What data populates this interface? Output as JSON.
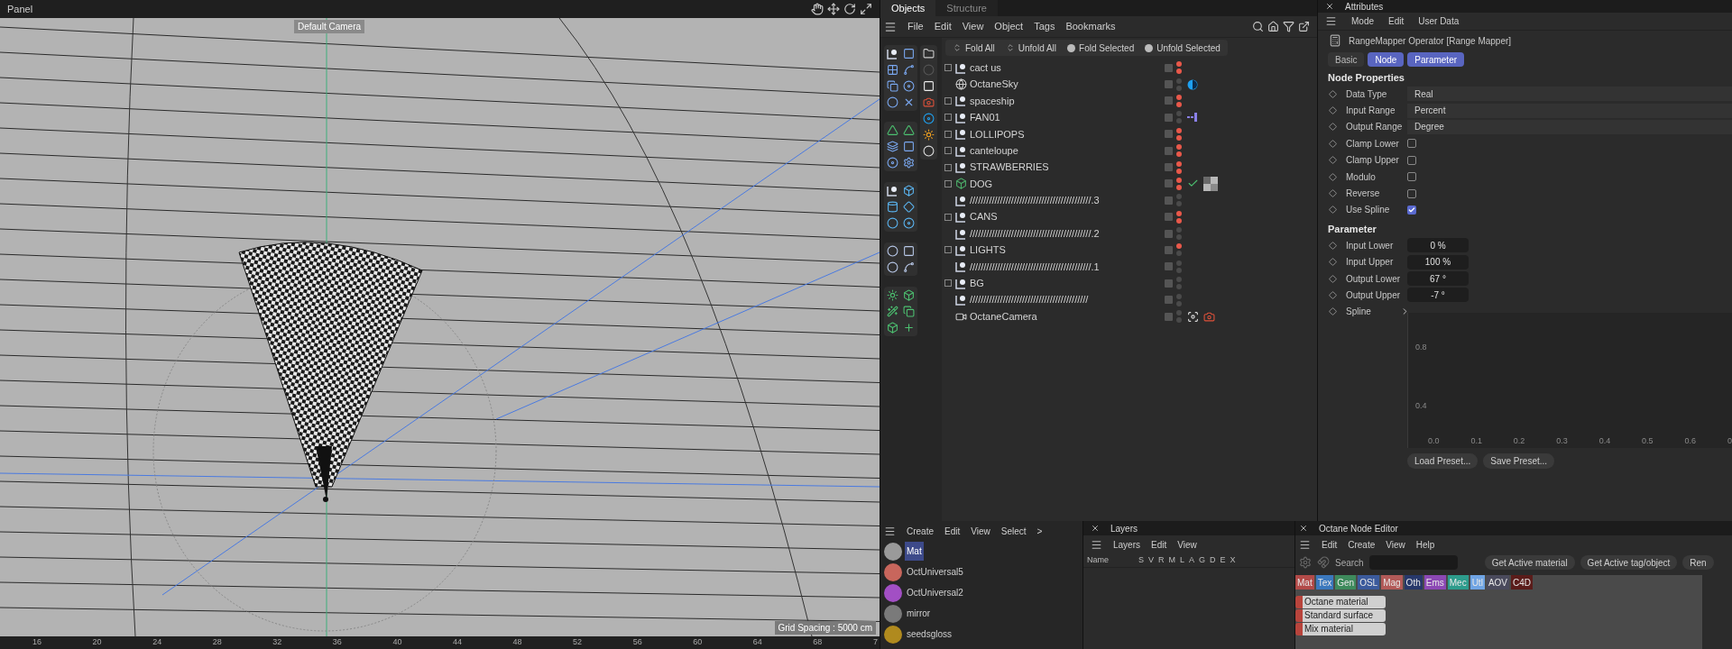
{
  "viewport": {
    "panel_menu": "Panel",
    "camera": "Default Camera",
    "grid_spacing": "Grid Spacing : 5000 cm",
    "ruler": [
      "16",
      "20",
      "24",
      "28",
      "32",
      "36",
      "40",
      "44",
      "48",
      "52",
      "56",
      "60",
      "64",
      "68",
      "7"
    ]
  },
  "object_manager": {
    "tabs": [
      {
        "label": "Objects",
        "selected": true
      },
      {
        "label": "Structure",
        "selected": false
      }
    ],
    "menu": [
      "File",
      "Edit",
      "View",
      "Object",
      "Tags",
      "Bookmarks"
    ],
    "fold_buttons": [
      {
        "label": "Fold All",
        "kind": "fold"
      },
      {
        "label": "Unfold All",
        "kind": "unfold"
      },
      {
        "label": "Fold Selected",
        "kind": "dot"
      },
      {
        "label": "Unfold Selected",
        "kind": "dot"
      }
    ],
    "objects": [
      {
        "name": "cact us",
        "kind": "null",
        "expandable": true,
        "editor_hidden": true,
        "render_hidden": true
      },
      {
        "name": "OctaneSky",
        "kind": "sky",
        "expandable": false,
        "editor_hidden": false,
        "render_hidden": false,
        "tags": [
          {
            "kind": "sky"
          }
        ]
      },
      {
        "name": "spaceship",
        "kind": "null",
        "expandable": true,
        "editor_hidden": true,
        "render_hidden": true
      },
      {
        "name": "FAN01",
        "kind": "null",
        "expandable": true,
        "editor_hidden": false,
        "render_hidden": false,
        "tags": [
          {
            "kind": "array"
          }
        ]
      },
      {
        "name": "LOLLIPOPS",
        "kind": "null",
        "expandable": true,
        "editor_hidden": true,
        "render_hidden": true
      },
      {
        "name": "canteloupe",
        "kind": "null",
        "expandable": true,
        "editor_hidden": true,
        "render_hidden": true
      },
      {
        "name": "STRAWBERRIES",
        "kind": "null",
        "expandable": true,
        "editor_hidden": true,
        "render_hidden": true
      },
      {
        "name": "DOG",
        "kind": "cube",
        "expandable": true,
        "editor_hidden": true,
        "render_hidden": true,
        "tags": [
          {
            "kind": "check"
          },
          {
            "kind": "texture"
          }
        ]
      },
      {
        "name": "////////////////////////////////////////////.3",
        "kind": "null",
        "expandable": false,
        "editor_hidden": false,
        "render_hidden": false
      },
      {
        "name": "CANS",
        "kind": "null",
        "expandable": true,
        "editor_hidden": true,
        "render_hidden": true
      },
      {
        "name": "////////////////////////////////////////////.2",
        "kind": "null",
        "expandable": false,
        "editor_hidden": false,
        "render_hidden": false
      },
      {
        "name": "LIGHTS",
        "kind": "null",
        "expandable": true,
        "editor_hidden": true,
        "render_hidden": false
      },
      {
        "name": "////////////////////////////////////////////.1",
        "kind": "null",
        "expandable": false,
        "editor_hidden": false,
        "render_hidden": false
      },
      {
        "name": "BG",
        "kind": "null",
        "expandable": true,
        "editor_hidden": false,
        "render_hidden": false
      },
      {
        "name": "///////////////////////////////////////////",
        "kind": "null",
        "expandable": false,
        "editor_hidden": false,
        "render_hidden": false
      },
      {
        "name": "OctaneCamera",
        "kind": "camera",
        "expandable": false,
        "editor_hidden": false,
        "render_hidden": false,
        "tags": [
          {
            "kind": "target"
          },
          {
            "kind": "camera"
          }
        ]
      }
    ]
  },
  "attributes": {
    "title": "Attributes",
    "menu": [
      "Mode",
      "Edit",
      "User Data"
    ],
    "object": "RangeMapper Operator [Range Mapper]",
    "tabs": [
      {
        "label": "Basic",
        "selected": false
      },
      {
        "label": "Node",
        "selected": true
      },
      {
        "label": "Parameter",
        "selected": true
      }
    ],
    "sections": [
      {
        "title": "Node Properties",
        "rows": [
          {
            "label": "Data Type",
            "kind": "dropdown",
            "value": "Real"
          },
          {
            "label": "Input Range",
            "kind": "dropdown",
            "value": "Percent"
          },
          {
            "label": "Output Range",
            "kind": "dropdown",
            "value": "Degree"
          },
          {
            "label": "Clamp Lower",
            "kind": "checkbox",
            "checked": false
          },
          {
            "label": "Clamp Upper",
            "kind": "checkbox",
            "checked": false
          },
          {
            "label": "Modulo",
            "kind": "checkbox",
            "checked": false
          },
          {
            "label": "Reverse",
            "kind": "checkbox",
            "checked": false
          },
          {
            "label": "Use Spline",
            "kind": "checkbox",
            "checked": true
          }
        ]
      },
      {
        "title": "Parameter",
        "rows": [
          {
            "label": "Input Lower",
            "kind": "number",
            "value": "0 %"
          },
          {
            "label": "Input Upper",
            "kind": "number",
            "value": "100 %"
          },
          {
            "label": "Output Lower",
            "kind": "number",
            "value": "67 °"
          },
          {
            "label": "Output Upper",
            "kind": "number",
            "value": "-7 °"
          },
          {
            "label": "Spline",
            "kind": "link"
          }
        ]
      }
    ],
    "spline_graph": {
      "y_labels": [
        "0.8",
        "0.4"
      ],
      "x_labels": [
        "0.0",
        "0.1",
        "0.2",
        "0.3",
        "0.4",
        "0.5",
        "0.6",
        "0"
      ]
    },
    "buttons": [
      "Load Preset...",
      "Save Preset..."
    ]
  },
  "material_manager": {
    "menu": [
      "Create",
      "Edit",
      "View",
      "Select"
    ],
    "more": ">",
    "materials": [
      {
        "name": "Mat",
        "selected": true,
        "color": "#9a9a9a"
      },
      {
        "name": "OctUniversal5",
        "selected": false,
        "color": "#c8665c"
      },
      {
        "name": "OctUniversal2",
        "selected": false,
        "color": "#a24fc4"
      },
      {
        "name": "mirror",
        "selected": false,
        "color": "#7a7a7a"
      },
      {
        "name": "seedsgloss",
        "selected": false,
        "color": "#b08a1e"
      }
    ]
  },
  "layers": {
    "title": "Layers",
    "menu": [
      "Layers",
      "Edit",
      "View"
    ],
    "columns": [
      "Name",
      "S",
      "V",
      "R",
      "M",
      "L",
      "A",
      "G",
      "D",
      "E",
      "X"
    ]
  },
  "node_editor": {
    "title": "Octane Node Editor",
    "menu": [
      "Edit",
      "Create",
      "View",
      "Help"
    ],
    "search_label": "Search",
    "buttons": [
      "Get Active material",
      "Get Active tag/object",
      "Ren"
    ],
    "categories": [
      {
        "label": "Mat",
        "color": "#b24a48"
      },
      {
        "label": "Tex",
        "color": "#3b78bd"
      },
      {
        "label": "Gen",
        "color": "#3e8a5c"
      },
      {
        "label": "OSL",
        "color": "#3b5a9c"
      },
      {
        "label": "Mag",
        "color": "#b25a58"
      },
      {
        "label": "Oth",
        "color": "#27386a"
      },
      {
        "label": "Ems",
        "color": "#8c48b4"
      },
      {
        "label": "Mec",
        "color": "#2d9c8c"
      },
      {
        "label": "Utl",
        "color": "#6fa4e4"
      },
      {
        "label": "AOV",
        "color": "#4a4a5c"
      },
      {
        "label": "C4D",
        "color": "#5a1c1a"
      }
    ],
    "nodes": [
      "Octane material",
      "Standard surface",
      "Mix material"
    ]
  }
}
